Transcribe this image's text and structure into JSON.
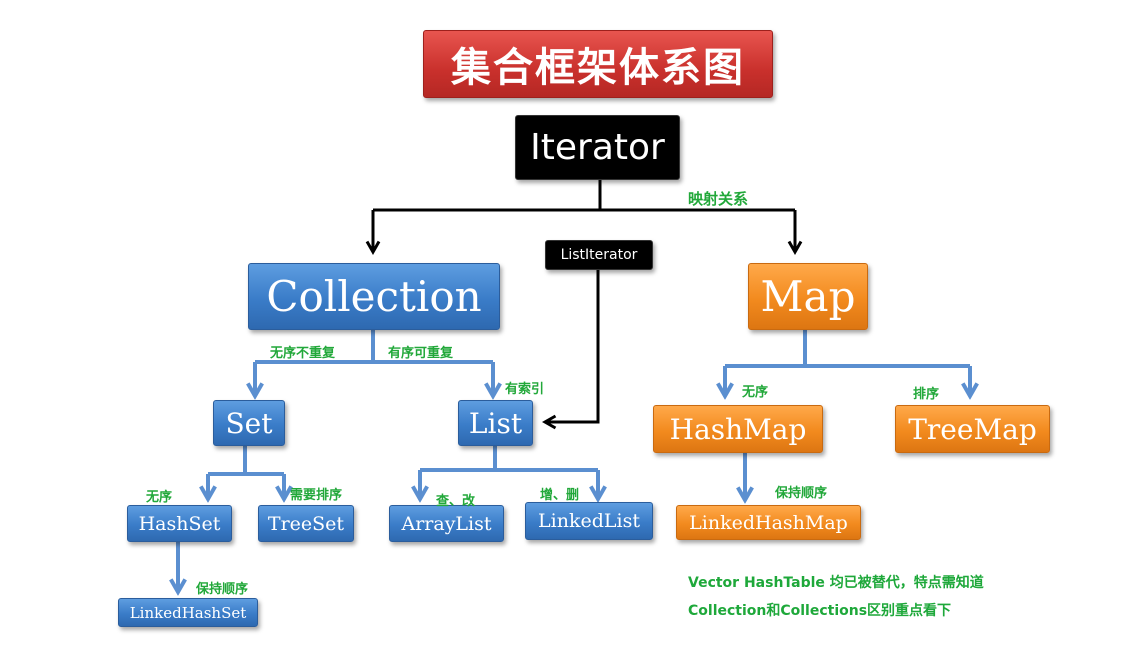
{
  "title": "集合框架体系图",
  "nodes": {
    "iterator": "Iterator",
    "list_iterator": "ListIterator",
    "collection": "Collection",
    "map": "Map",
    "set": "Set",
    "list": "List",
    "hashmap": "HashMap",
    "treemap": "TreeMap",
    "hashset": "HashSet",
    "treeset": "TreeSet",
    "arraylist": "ArrayList",
    "linkedlist": "LinkedList",
    "linkedhashmap": "LinkedHashMap",
    "linkedhashset": "LinkedHashSet"
  },
  "edge_labels": {
    "mapping": "映射关系",
    "unordered_unique": "无序不重复",
    "ordered_repeatable": "有序可重复",
    "indexed": "有索引",
    "map_unordered": "无序",
    "map_sorted": "排序",
    "set_unordered": "无序",
    "set_needs_sort": "需要排序",
    "query_modify": "查、改",
    "add_delete": "增、删",
    "map_keep_order": "保持顺序",
    "set_keep_order": "保持顺序"
  },
  "notes": {
    "line1": "Vector HashTable 均已被替代，特点需知道",
    "line2": "Collection和Collections区别重点看下"
  },
  "colors": {
    "blue": "#3a7cc8",
    "orange": "#f28a1e",
    "red": "#c9302c",
    "black": "#000000",
    "green_label": "#22a83a",
    "blue_connector": "#5b8fd0"
  }
}
